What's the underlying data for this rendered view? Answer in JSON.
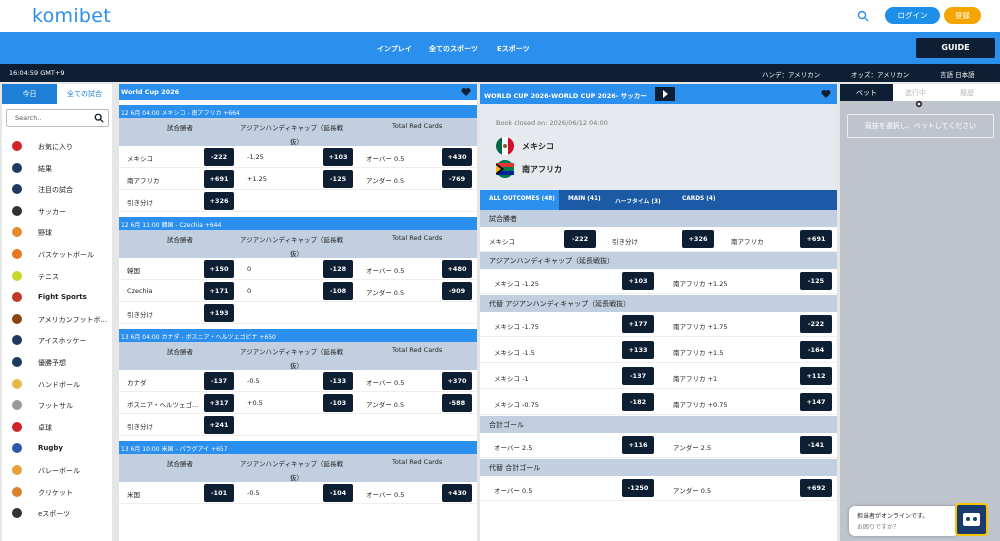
{
  "header": {
    "logo": "komibet",
    "login": "ログイン",
    "register": "登録"
  },
  "nav": {
    "items": [
      "インプレイ",
      "全てのスポーツ",
      "Eスポーツ"
    ],
    "guide": "GUIDE"
  },
  "subbar": {
    "time": "16:04:59 GMT+9",
    "handicap": "ハンデ：アメリカン",
    "odds": "オッズ：アメリカン",
    "lang": "言語 日本語"
  },
  "sidebar": {
    "tabs": [
      "今日",
      "全ての試合"
    ],
    "search_placeholder": "Search..",
    "items": [
      {
        "label": "お気に入り",
        "icon": "heart-icon",
        "color": "#d2232a",
        "bold": false
      },
      {
        "label": "結果",
        "icon": "list-icon",
        "color": "#1e3a5f",
        "bold": false
      },
      {
        "label": "注目の試合",
        "icon": "calendar-icon",
        "color": "#1e3a5f",
        "bold": false
      },
      {
        "label": "サッカー",
        "icon": "soccer-icon",
        "color": "#333",
        "bold": false
      },
      {
        "label": "野球",
        "icon": "baseball-icon",
        "color": "#e38b2e",
        "bold": false
      },
      {
        "label": "バスケットボール",
        "icon": "basketball-icon",
        "color": "#e87722",
        "bold": false
      },
      {
        "label": "テニス",
        "icon": "tennis-icon",
        "color": "#c5d92d",
        "bold": false
      },
      {
        "label": "Fight Sports",
        "icon": "glove-icon",
        "color": "#c0392b",
        "bold": true
      },
      {
        "label": "アメリカンフットボ...",
        "icon": "football-icon",
        "color": "#8b4513",
        "bold": false
      },
      {
        "label": "アイスホッケー",
        "icon": "hockey-icon",
        "color": "#1e3a5f",
        "bold": false
      },
      {
        "label": "優勝予想",
        "icon": "medal-icon",
        "color": "#1e3a5f",
        "bold": false
      },
      {
        "label": "ハンドボール",
        "icon": "handball-icon",
        "color": "#e6b84c",
        "bold": false
      },
      {
        "label": "フットサル",
        "icon": "futsal-icon",
        "color": "#999",
        "bold": false
      },
      {
        "label": "卓球",
        "icon": "pingpong-icon",
        "color": "#d2232a",
        "bold": false
      },
      {
        "label": "Rugby",
        "icon": "rugby-icon",
        "color": "#2b5aa8",
        "bold": true
      },
      {
        "label": "バレーボール",
        "icon": "volleyball-icon",
        "color": "#e8a23a",
        "bold": false
      },
      {
        "label": "クリケット",
        "icon": "cricket-icon",
        "color": "#d9822b",
        "bold": false
      },
      {
        "label": "eスポーツ",
        "icon": "gamepad-icon",
        "color": "#333",
        "bold": false
      }
    ]
  },
  "league": "World Cup 2026",
  "col_headers": {
    "result": "試合勝者",
    "ah1": "アジアンハンディキャップ（延長戦",
    "ah2": "抜）",
    "cards": "Total Red Cards"
  },
  "matches": [
    {
      "title": "12 6月 04:00  メキシコ - 南アフリカ +664",
      "rows": [
        {
          "team": "メキシコ",
          "odds": "-222",
          "hc": "-1.25",
          "hco": "+103",
          "ou": "オーバー 0.5",
          "ouo": "+430"
        },
        {
          "team": "南アフリカ",
          "odds": "+691",
          "hc": "+1.25",
          "hco": "-125",
          "ou": "アンダー 0.5",
          "ouo": "-769"
        },
        {
          "team": "引き分け",
          "odds": "+326"
        }
      ]
    },
    {
      "title": "12 6月 11:00  韓国 - Czechia +644",
      "rows": [
        {
          "team": "韓国",
          "odds": "+150",
          "hc": "0",
          "hco": "-128",
          "ou": "オーバー 0.5",
          "ouo": "+480"
        },
        {
          "team": "Czechia",
          "odds": "+171",
          "hc": "0",
          "hco": "-108",
          "ou": "アンダー 0.5",
          "ouo": "-909"
        },
        {
          "team": "引き分け",
          "odds": "+193"
        }
      ]
    },
    {
      "title": "13 6月 04:00  カナダ - ボスニア・ヘルツェゴビナ +650",
      "rows": [
        {
          "team": "カナダ",
          "odds": "-137",
          "hc": "-0.5",
          "hco": "-133",
          "ou": "オーバー 0.5",
          "ouo": "+370"
        },
        {
          "team": "ボスニア・ヘルツェゴ...",
          "odds": "+317",
          "hc": "+0.5",
          "hco": "-103",
          "ou": "アンダー 0.5",
          "ouo": "-588"
        },
        {
          "team": "引き分け",
          "odds": "+241"
        }
      ]
    },
    {
      "title": "13 6月 10:00  米国 - パラグアイ +657",
      "rows": [
        {
          "team": "米国",
          "odds": "-101",
          "hc": "-0.5",
          "hco": "-104",
          "ou": "オーバー 0.5",
          "ouo": "+430"
        }
      ]
    }
  ],
  "detail": {
    "title": "WORLD CUP 2026-WORLD CUP 2026- サッカー",
    "book": "Book closed on: 2026/06/12 04:00",
    "home": "メキシコ",
    "away": "南アフリカ",
    "tabs": [
      "ALL OUTCOMES (48)",
      "MAIN (41)",
      "ハーフタイム (3)",
      "CARDS (4)"
    ],
    "winner": {
      "title": "試合勝者",
      "cells": [
        {
          "l": "メキシコ",
          "o": "-222"
        },
        {
          "l": "引き分け",
          "o": "+326"
        },
        {
          "l": "南アフリカ",
          "o": "+691"
        }
      ]
    },
    "ah": {
      "title": "アジアンハンディキャップ（延長戦抜）",
      "rows": [
        {
          "l": "メキシコ -1.25",
          "o": "+103",
          "r": "南アフリカ +1.25",
          "ro": "-125"
        }
      ]
    },
    "alt_ah": {
      "title": "代替 アジアンハンディキャップ（延長戦抜）",
      "rows": [
        {
          "l": "メキシコ -1.75",
          "o": "+177",
          "r": "南アフリカ +1.75",
          "ro": "-222"
        },
        {
          "l": "メキシコ -1.5",
          "o": "+133",
          "r": "南アフリカ +1.5",
          "ro": "-164"
        },
        {
          "l": "メキシコ -1",
          "o": "-137",
          "r": "南アフリカ +1",
          "ro": "+112"
        },
        {
          "l": "メキシコ -0.75",
          "o": "-182",
          "r": "南アフリカ +0.75",
          "ro": "+147"
        }
      ]
    },
    "goals": {
      "title": "合計ゴール",
      "rows": [
        {
          "l": "オーバー 2.5",
          "o": "+116",
          "r": "アンダー 2.5",
          "ro": "-141"
        }
      ]
    },
    "alt_goals": {
      "title": "代替 合計ゴール",
      "rows": [
        {
          "l": "オーバー 0.5",
          "o": "-1250",
          "r": "アンダー 0.5",
          "ro": "+692"
        }
      ]
    }
  },
  "betslip": {
    "tabs": [
      "ベット",
      "進行中",
      "履歴"
    ],
    "msg": "競技を選択し、ベットしてください"
  },
  "chat": {
    "line1": "担当者がオンラインです。",
    "line2": "お困りですか？"
  },
  "colors": {
    "brand": "#2b8fee",
    "dark": "#0e1e33",
    "login": "#1e8fe8",
    "register": "#f6a400"
  }
}
